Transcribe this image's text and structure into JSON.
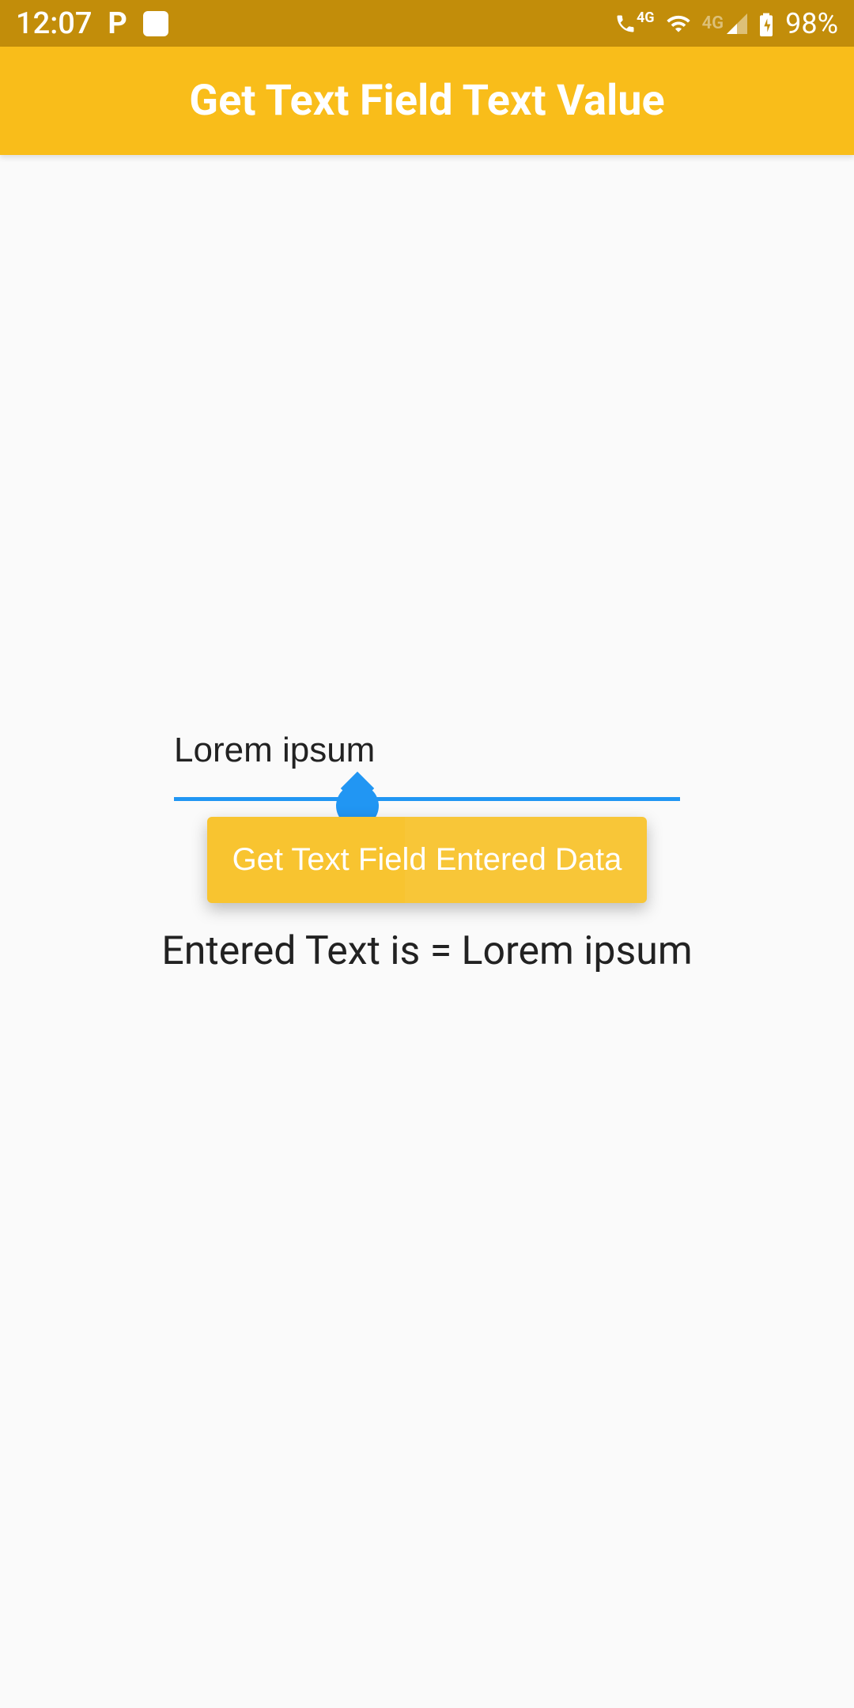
{
  "status_bar": {
    "time": "12:07",
    "network_label_1": "4G",
    "network_label_2": "4G",
    "battery": "98%"
  },
  "app_bar": {
    "title": "Get Text Field Text Value"
  },
  "content": {
    "text_field_value": "Lorem ipsum",
    "button_label": "Get Text Field Entered Data",
    "result_text": "Entered Text is = Lorem ipsum"
  },
  "colors": {
    "status_bar_bg": "#c28d0a",
    "app_bar_bg": "#f9bd1a",
    "button_bg": "#f8c430",
    "accent_blue": "#2196f3"
  }
}
